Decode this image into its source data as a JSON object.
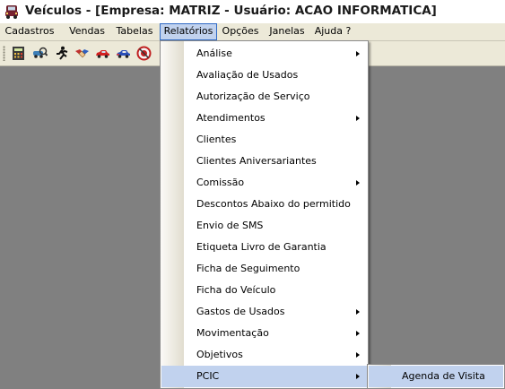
{
  "window": {
    "title": "Veículos - [Empresa: MATRIZ - Usuário: ACAO INFORMATICA]",
    "icon": "car-app-icon"
  },
  "menubar": {
    "items": [
      {
        "label": "Cadastros"
      },
      {
        "label": "Vendas"
      },
      {
        "label": "Tabelas"
      },
      {
        "label": "Relatórios",
        "active": true
      },
      {
        "label": "Opções"
      },
      {
        "label": "Janelas"
      },
      {
        "label": "Ajuda ?"
      }
    ]
  },
  "toolbar": {
    "buttons": [
      "calculator-icon",
      "search-car-icon",
      "running-man-icon",
      "handshake-icon",
      "red-car-icon",
      "blue-car-icon",
      "no-entry-icon"
    ]
  },
  "relatorios_menu": {
    "items": [
      {
        "label": "Análise",
        "submenu": true
      },
      {
        "label": "Avaliação de Usados",
        "submenu": false
      },
      {
        "label": "Autorização de Serviço",
        "submenu": false
      },
      {
        "label": "Atendimentos",
        "submenu": true
      },
      {
        "label": "Clientes",
        "submenu": false
      },
      {
        "label": "Clientes Aniversariantes",
        "submenu": false
      },
      {
        "label": "Comissão",
        "submenu": true
      },
      {
        "label": "Descontos Abaixo do permitido",
        "submenu": false
      },
      {
        "label": "Envio de SMS",
        "submenu": false
      },
      {
        "label": "Etiqueta Livro de Garantia",
        "submenu": false
      },
      {
        "label": "Ficha de Seguimento",
        "submenu": false
      },
      {
        "label": "Ficha do Veículo",
        "submenu": false
      },
      {
        "label": "Gastos de Usados",
        "submenu": true
      },
      {
        "label": "Movimentação",
        "submenu": true
      },
      {
        "label": "Objetivos",
        "submenu": true
      },
      {
        "label": "PCIC",
        "submenu": true,
        "highlighted": true
      }
    ]
  },
  "pcic_submenu": {
    "items": [
      {
        "label": "Agenda de Visita",
        "highlighted": true
      }
    ]
  },
  "colors": {
    "desktop": "#808080",
    "menubar": "#ece9d8",
    "highlight": "#c1d2ee",
    "highlight_border": "#316ac5"
  }
}
